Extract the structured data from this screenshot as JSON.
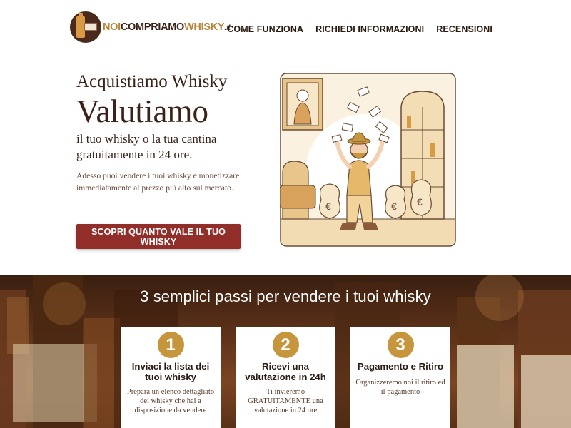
{
  "logo": {
    "part1": "NOI",
    "part2": "COMPRIAMO",
    "part3": "WHISKY",
    "part4": ".it"
  },
  "nav": {
    "items": [
      {
        "label": "COME FUNZIONA"
      },
      {
        "label": "RICHIEDI INFORMAZIONI"
      },
      {
        "label": "RECENSIONI"
      }
    ]
  },
  "hero": {
    "subtitle": "Acquistiamo Whisky",
    "title": "Valutiamo",
    "tagline": "il tuo whisky o la tua cantina gratuitamente in 24 ore.",
    "description": "Adesso puoi vendere i tuoi whisky e monetizzare immediatamente al prezzo più alto sul mercato.",
    "cta_label": "SCOPRI QUANTO VALE IL TUO WHISKY"
  },
  "steps": {
    "title": "3 semplici passi per vendere i tuoi whisky",
    "cards": [
      {
        "number": "1",
        "title": "Inviaci la lista dei tuoi whisky",
        "description": "Prepara un elenco dettagliato dei whisky che hai a disposizione da vendere"
      },
      {
        "number": "2",
        "title": "Ricevi una valutazione in 24h",
        "description": "Ti invieremo GRATUITAMENTE una valutazione in 24 ore"
      },
      {
        "number": "3",
        "title": "Pagamento e Ritiro",
        "description": "Organizzeremo noi il ritiro ed il pagamento"
      }
    ]
  },
  "colors": {
    "brand_gold": "#c7953c",
    "brand_brown": "#3a2218",
    "cta_red": "#922e2a"
  }
}
